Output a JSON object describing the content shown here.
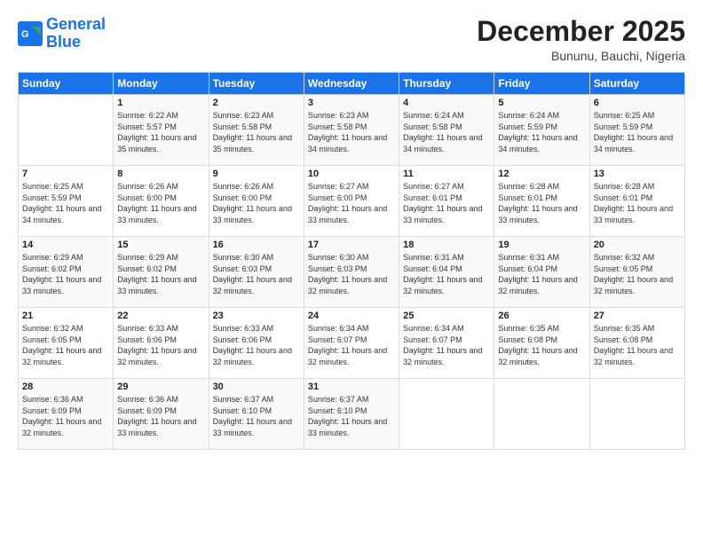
{
  "header": {
    "logo_line1": "General",
    "logo_line2": "Blue",
    "month": "December 2025",
    "location": "Bununu, Bauchi, Nigeria"
  },
  "days_of_week": [
    "Sunday",
    "Monday",
    "Tuesday",
    "Wednesday",
    "Thursday",
    "Friday",
    "Saturday"
  ],
  "weeks": [
    [
      {
        "day": "",
        "sunrise": "",
        "sunset": "",
        "daylight": ""
      },
      {
        "day": "1",
        "sunrise": "6:22 AM",
        "sunset": "5:57 PM",
        "daylight": "11 hours and 35 minutes."
      },
      {
        "day": "2",
        "sunrise": "6:23 AM",
        "sunset": "5:58 PM",
        "daylight": "11 hours and 35 minutes."
      },
      {
        "day": "3",
        "sunrise": "6:23 AM",
        "sunset": "5:58 PM",
        "daylight": "11 hours and 34 minutes."
      },
      {
        "day": "4",
        "sunrise": "6:24 AM",
        "sunset": "5:58 PM",
        "daylight": "11 hours and 34 minutes."
      },
      {
        "day": "5",
        "sunrise": "6:24 AM",
        "sunset": "5:59 PM",
        "daylight": "11 hours and 34 minutes."
      },
      {
        "day": "6",
        "sunrise": "6:25 AM",
        "sunset": "5:59 PM",
        "daylight": "11 hours and 34 minutes."
      }
    ],
    [
      {
        "day": "7",
        "sunrise": "6:25 AM",
        "sunset": "5:59 PM",
        "daylight": "11 hours and 34 minutes."
      },
      {
        "day": "8",
        "sunrise": "6:26 AM",
        "sunset": "6:00 PM",
        "daylight": "11 hours and 33 minutes."
      },
      {
        "day": "9",
        "sunrise": "6:26 AM",
        "sunset": "6:00 PM",
        "daylight": "11 hours and 33 minutes."
      },
      {
        "day": "10",
        "sunrise": "6:27 AM",
        "sunset": "6:00 PM",
        "daylight": "11 hours and 33 minutes."
      },
      {
        "day": "11",
        "sunrise": "6:27 AM",
        "sunset": "6:01 PM",
        "daylight": "11 hours and 33 minutes."
      },
      {
        "day": "12",
        "sunrise": "6:28 AM",
        "sunset": "6:01 PM",
        "daylight": "11 hours and 33 minutes."
      },
      {
        "day": "13",
        "sunrise": "6:28 AM",
        "sunset": "6:01 PM",
        "daylight": "11 hours and 33 minutes."
      }
    ],
    [
      {
        "day": "14",
        "sunrise": "6:29 AM",
        "sunset": "6:02 PM",
        "daylight": "11 hours and 33 minutes."
      },
      {
        "day": "15",
        "sunrise": "6:29 AM",
        "sunset": "6:02 PM",
        "daylight": "11 hours and 33 minutes."
      },
      {
        "day": "16",
        "sunrise": "6:30 AM",
        "sunset": "6:03 PM",
        "daylight": "11 hours and 32 minutes."
      },
      {
        "day": "17",
        "sunrise": "6:30 AM",
        "sunset": "6:03 PM",
        "daylight": "11 hours and 32 minutes."
      },
      {
        "day": "18",
        "sunrise": "6:31 AM",
        "sunset": "6:04 PM",
        "daylight": "11 hours and 32 minutes."
      },
      {
        "day": "19",
        "sunrise": "6:31 AM",
        "sunset": "6:04 PM",
        "daylight": "11 hours and 32 minutes."
      },
      {
        "day": "20",
        "sunrise": "6:32 AM",
        "sunset": "6:05 PM",
        "daylight": "11 hours and 32 minutes."
      }
    ],
    [
      {
        "day": "21",
        "sunrise": "6:32 AM",
        "sunset": "6:05 PM",
        "daylight": "11 hours and 32 minutes."
      },
      {
        "day": "22",
        "sunrise": "6:33 AM",
        "sunset": "6:06 PM",
        "daylight": "11 hours and 32 minutes."
      },
      {
        "day": "23",
        "sunrise": "6:33 AM",
        "sunset": "6:06 PM",
        "daylight": "11 hours and 32 minutes."
      },
      {
        "day": "24",
        "sunrise": "6:34 AM",
        "sunset": "6:07 PM",
        "daylight": "11 hours and 32 minutes."
      },
      {
        "day": "25",
        "sunrise": "6:34 AM",
        "sunset": "6:07 PM",
        "daylight": "11 hours and 32 minutes."
      },
      {
        "day": "26",
        "sunrise": "6:35 AM",
        "sunset": "6:08 PM",
        "daylight": "11 hours and 32 minutes."
      },
      {
        "day": "27",
        "sunrise": "6:35 AM",
        "sunset": "6:08 PM",
        "daylight": "11 hours and 32 minutes."
      }
    ],
    [
      {
        "day": "28",
        "sunrise": "6:36 AM",
        "sunset": "6:09 PM",
        "daylight": "11 hours and 32 minutes."
      },
      {
        "day": "29",
        "sunrise": "6:36 AM",
        "sunset": "6:09 PM",
        "daylight": "11 hours and 33 minutes."
      },
      {
        "day": "30",
        "sunrise": "6:37 AM",
        "sunset": "6:10 PM",
        "daylight": "11 hours and 33 minutes."
      },
      {
        "day": "31",
        "sunrise": "6:37 AM",
        "sunset": "6:10 PM",
        "daylight": "11 hours and 33 minutes."
      },
      {
        "day": "",
        "sunrise": "",
        "sunset": "",
        "daylight": ""
      },
      {
        "day": "",
        "sunrise": "",
        "sunset": "",
        "daylight": ""
      },
      {
        "day": "",
        "sunrise": "",
        "sunset": "",
        "daylight": ""
      }
    ]
  ],
  "labels": {
    "sunrise": "Sunrise:",
    "sunset": "Sunset:",
    "daylight": "Daylight:"
  }
}
